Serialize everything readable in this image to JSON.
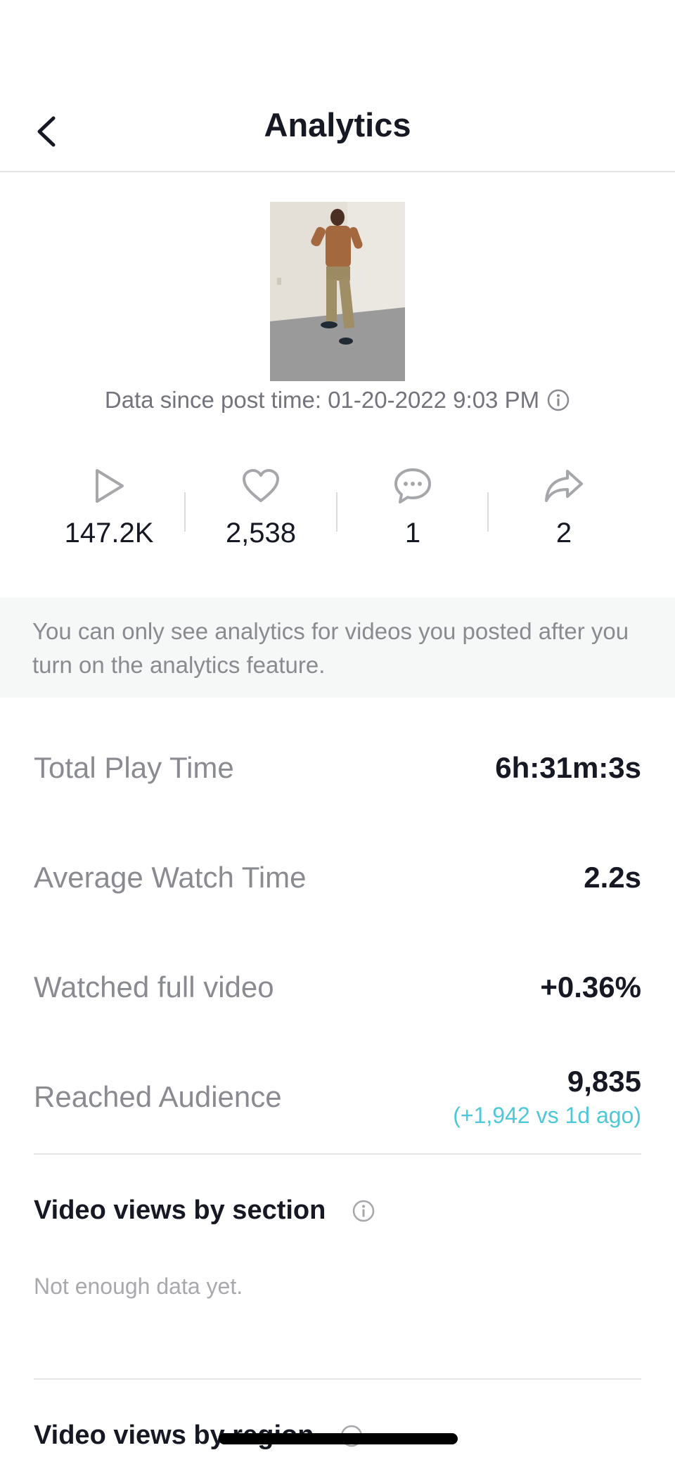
{
  "header": {
    "title": "Analytics"
  },
  "video": {
    "data_since": "Data since post time: 01-20-2022 9:03 PM"
  },
  "stats": {
    "plays": "147.2K",
    "likes": "2,538",
    "comments": "1",
    "shares": "2"
  },
  "notice": "You can only see analytics for videos you posted after you turn on the analytics feature.",
  "metrics": [
    {
      "label": "Total Play Time",
      "value": "6h:31m:3s"
    },
    {
      "label": "Average Watch Time",
      "value": "2.2s"
    },
    {
      "label": "Watched full video",
      "value": "+0.36%"
    },
    {
      "label": "Reached Audience",
      "value": "9,835",
      "delta": "(+1,942 vs 1d ago)"
    }
  ],
  "sections": {
    "by_section": {
      "title": "Video views by section",
      "empty": "Not enough data yet."
    },
    "by_region": {
      "title": "Video views by region"
    }
  },
  "colors": {
    "accent_teal": "#4ec7d8",
    "text_primary": "#161823",
    "text_secondary": "#8a8b91"
  }
}
